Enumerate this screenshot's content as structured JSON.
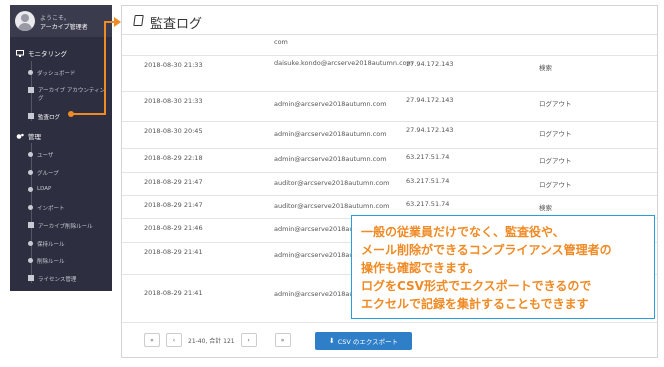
{
  "sidebar": {
    "welcome": "ようこそ。",
    "user": "アーカイブ管理者",
    "sections": [
      {
        "label": "モニタリング",
        "icon": "monitor-icon"
      },
      {
        "label": "管理",
        "icon": "cogs-icon"
      }
    ],
    "monitoring_items": [
      {
        "label": "ダッシュボード",
        "icon": "dashboard-icon"
      },
      {
        "label": "アーカイブ アカウンティング",
        "icon": "accounting-icon"
      },
      {
        "label": "監査ログ",
        "icon": "book-icon"
      }
    ],
    "admin_items": [
      {
        "label": "ユーザ",
        "icon": "user-icon"
      },
      {
        "label": "グループ",
        "icon": "users-icon"
      },
      {
        "label": "LDAP",
        "icon": "key-icon"
      },
      {
        "label": "インポート",
        "icon": "lightbulb-icon"
      },
      {
        "label": "アーカイブ削除ルール",
        "icon": "trash-icon"
      },
      {
        "label": "保持ルール",
        "icon": "clock-icon"
      },
      {
        "label": "削除ルール",
        "icon": "gavel-icon"
      },
      {
        "label": "ライセンス管理",
        "icon": "license-icon"
      }
    ]
  },
  "panel": {
    "title": "監査ログ",
    "rows": [
      {
        "time": "",
        "user": "com",
        "ip": "",
        "action": ""
      },
      {
        "time": "2018-08-30 21:33",
        "user": "daisuke.kondo@arcserve2018autumn.com",
        "ip": "27.94.172.143",
        "action": "検索"
      },
      {
        "time": "2018-08-30 21:33",
        "user": "admin@arcserve2018autumn.com",
        "ip": "27.94.172.143",
        "action": "ログアウト"
      },
      {
        "time": "2018-08-30 20:45",
        "user": "admin@arcserve2018autumn.com",
        "ip": "27.94.172.143",
        "action": "ログアウト"
      },
      {
        "time": "2018-08-29 22:18",
        "user": "admin@arcserve2018autumn.com",
        "ip": "63.217.51.74",
        "action": "ログアウト"
      },
      {
        "time": "2018-08-29 21:47",
        "user": "auditor@arcserve2018autumn.com",
        "ip": "63.217.51.74",
        "action": "ログアウト"
      },
      {
        "time": "2018-08-29 21:47",
        "user": "auditor@arcserve2018autumn.com",
        "ip": "63.217.51.74",
        "action": "検索"
      },
      {
        "time": "2018-08-29 21:46",
        "user": "admin@arcserve2018autumn.com",
        "ip": "",
        "action": ""
      },
      {
        "time": "2018-08-29 21:41",
        "user": "admin@arcserve2018autumn",
        "ip": "",
        "action": ""
      },
      {
        "time": "2018-08-29 21:41",
        "user": "admin@arcserve2018au",
        "ip": "",
        "action": ""
      }
    ],
    "pager": {
      "first": "«",
      "prev": "‹",
      "info": "21-40, 合計 121",
      "next": "›",
      "last": "»"
    },
    "csv_button": "CSV のエクスポート"
  },
  "callout": {
    "lines": [
      "一般の従業員だけでなく、監査役や、",
      "メール削除ができるコンプライアンス管理者の",
      "操作も確認できます。",
      "ログをCSV形式でエクスポートできるので",
      "エクセルで記録を集計することもできます"
    ]
  },
  "colors": {
    "sidebar_bg": "#2d2e3f",
    "accent_orange": "#f08a24",
    "callout_border": "#2a9ed8",
    "button_blue": "#2e7ec8"
  }
}
